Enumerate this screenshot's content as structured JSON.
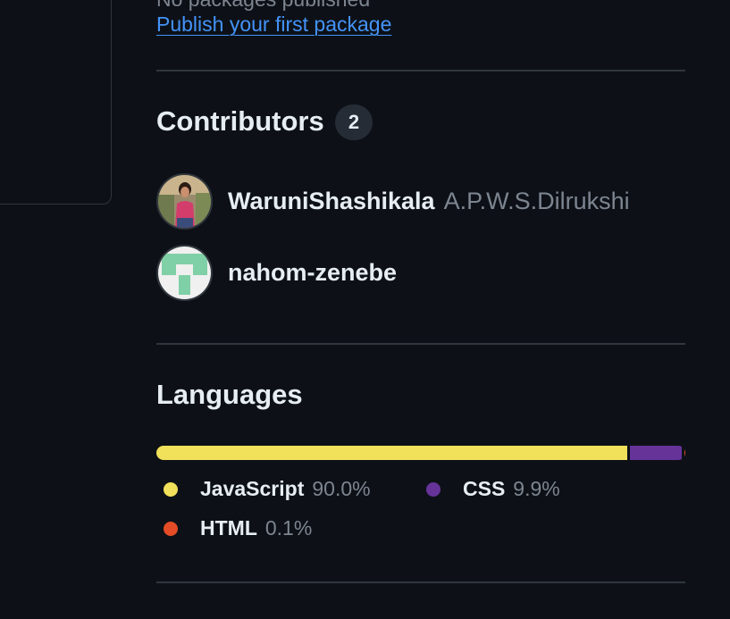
{
  "packages": {
    "empty_text": "No packages published",
    "publish_link": "Publish your first package"
  },
  "contributors": {
    "title": "Contributors",
    "count": "2",
    "items": [
      {
        "login": "WaruniShashikala",
        "name": "A.P.W.S.Dilrukshi",
        "avatar": "photo-avatar"
      },
      {
        "login": "nahom-zenebe",
        "name": "",
        "avatar": "identicon-avatar"
      }
    ]
  },
  "languages": {
    "title": "Languages",
    "items": [
      {
        "name": "JavaScript",
        "percent": "90.0%",
        "value": 90.0,
        "color": "#f1e05a"
      },
      {
        "name": "CSS",
        "percent": "9.9%",
        "value": 9.9,
        "color": "#663399"
      },
      {
        "name": "HTML",
        "percent": "0.1%",
        "value": 0.1,
        "color": "#e34c26"
      }
    ]
  },
  "colors": {
    "background": "#0d1117",
    "border": "#30363d",
    "link": "#4493f8",
    "text": "#e6edf3",
    "muted": "#7d8590"
  }
}
